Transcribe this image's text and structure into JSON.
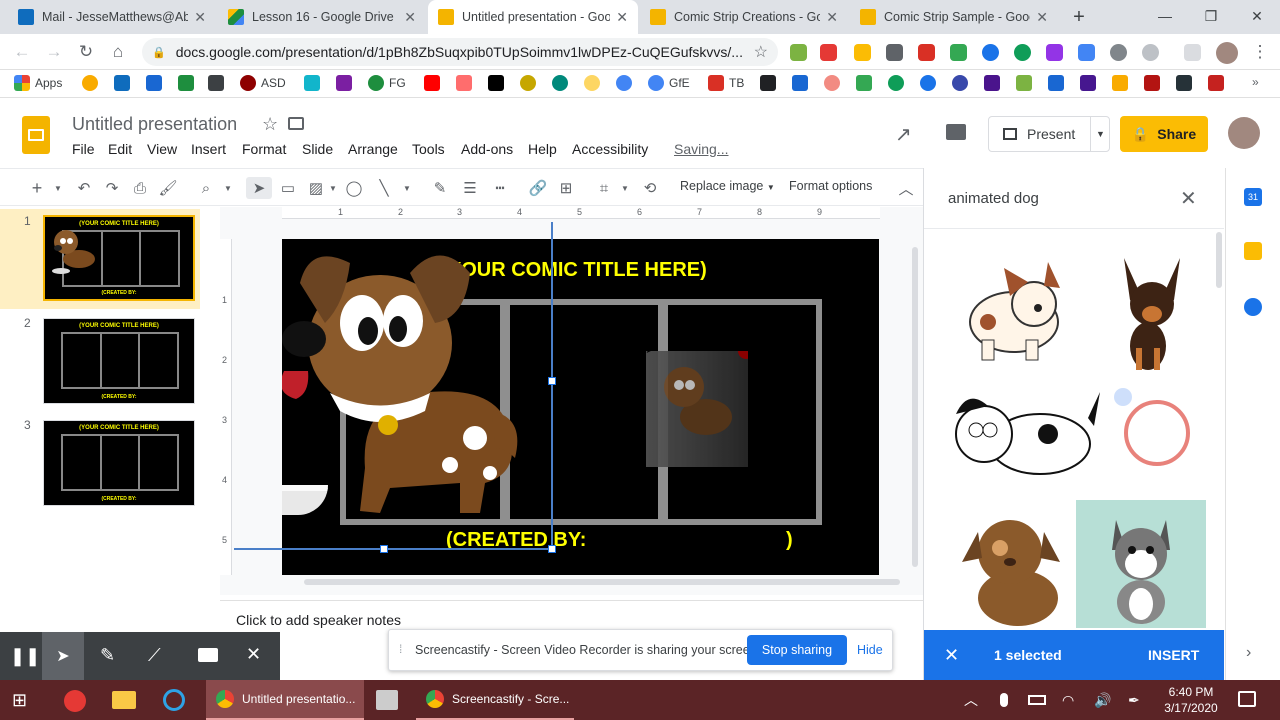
{
  "browser": {
    "tabs": [
      {
        "title": "Mail - JesseMatthews@Abi",
        "favcolor": "#0f6cbd",
        "active": false
      },
      {
        "title": "Lesson 16 - Google Drive",
        "favcolor": "#1e8e3e",
        "active": false
      },
      {
        "title": "Untitled presentation - Goo",
        "favcolor": "#f4b400",
        "active": true
      },
      {
        "title": "Comic Strip Creations - Go",
        "favcolor": "#f4b400",
        "active": false
      },
      {
        "title": "Comic Strip Sample - Goog",
        "favcolor": "#f4b400",
        "active": false
      }
    ],
    "new_tab": "+",
    "url": "docs.google.com/presentation/d/1pBh8ZbSuqxpib0TUpSoimmv1lwDPEz-CuQEGufskvvs/...",
    "bookmarks": [
      "Apps",
      "ASD",
      "FG",
      "GfE",
      "TB"
    ]
  },
  "docs": {
    "title": "Untitled presentation",
    "menu": [
      "File",
      "Edit",
      "View",
      "Insert",
      "Format",
      "Slide",
      "Arrange",
      "Tools",
      "Add-ons",
      "Help",
      "Accessibility"
    ],
    "saving": "Saving...",
    "present": "Present",
    "share": "Share"
  },
  "toolbar": {
    "replace_image": "Replace image",
    "format_options": "Format options"
  },
  "ruler": [
    "1",
    "2",
    "3",
    "4",
    "5",
    "6",
    "7",
    "8",
    "9"
  ],
  "vruler": [
    "1",
    "2",
    "3",
    "4",
    "5"
  ],
  "slides": [
    {
      "num": "1",
      "title": "(YOUR COMIC TITLE HERE)",
      "created": "(CREATED BY:"
    },
    {
      "num": "2",
      "title": "(YOUR COMIC TITLE HERE)",
      "created": "(CREATED BY:"
    },
    {
      "num": "3",
      "title": "(YOUR COMIC TITLE HERE)",
      "created": "(CREATED BY:"
    }
  ],
  "slide": {
    "title": "(YOUR COMIC TITLE HERE)",
    "created_by": "(CREATED BY:",
    "created_close": ")"
  },
  "notes_placeholder": "Click to add speaker notes",
  "search_panel": {
    "query": "animated dog",
    "selected_label": "1 selected",
    "insert": "INSERT"
  },
  "share_bar": {
    "message": "Screencastify - Screen Video Recorder is sharing your screen.",
    "stop": "Stop sharing",
    "hide": "Hide"
  },
  "taskbar": {
    "app1": "Untitled presentatio...",
    "app2": "Screencastify - Scre...",
    "time": "6:40 PM",
    "date": "3/17/2020"
  },
  "colors": {
    "accent": "#1a73e8",
    "share": "#fbbc04",
    "slide_title": "#ffff00",
    "taskbar": "#5b2426"
  }
}
